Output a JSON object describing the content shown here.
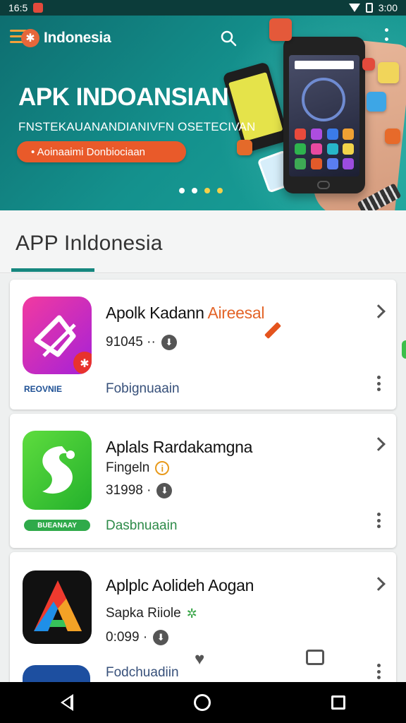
{
  "status_bar": {
    "time": "16:5",
    "right_text": "3:00"
  },
  "banner": {
    "brand": "Indonesia",
    "brand_logo_glyph": "✱",
    "title": "APK INDOANSIAN",
    "subtitle": "FNSTEKAUANANDIANIVFN OSETECIVAN",
    "cta_label": "• Aoinaaimi Donbiociaan",
    "search_icon": "search-icon",
    "menu_icon": "hamburger-icon",
    "overflow_icon": "more-vert-icon",
    "pager_dots": 4,
    "colors": {
      "bg_start": "#0e6e70",
      "bg_end": "#1aa39a",
      "cta": "#e95a2a",
      "accent_dot": "#f4d04a"
    }
  },
  "section": {
    "title": "APP Inldonesia",
    "accent_color": "#16877f"
  },
  "apps": [
    {
      "name_main": "Apolk Kadann ",
      "name_highlight": "Aireesal",
      "meta_value": "91045 ··",
      "developer": "Fobignuaain",
      "left_badge": "REOVNIE",
      "icon_colors": [
        "#f23aa0",
        "#a521d8"
      ]
    },
    {
      "name_main": "Aplals Rardakamgna",
      "sub_label": "Fingeln",
      "meta_value": "31998 ·",
      "developer": "Dasbnuaain",
      "left_badge": "BUEANAAY",
      "icon_colors": [
        "#5edc3e",
        "#24b12c"
      ]
    },
    {
      "name_main": "Aplplc Aolideh Aogan",
      "sub_label": "Sapka Riiole",
      "meta_value": "0:099 ·",
      "developer": "Fodchuadiin",
      "icon_colors": [
        "#ef3a2e",
        "#1f8fe8"
      ]
    }
  ],
  "nav": {
    "back_icon": "back-icon",
    "home_icon": "home-icon",
    "recents_icon": "recents-icon"
  }
}
